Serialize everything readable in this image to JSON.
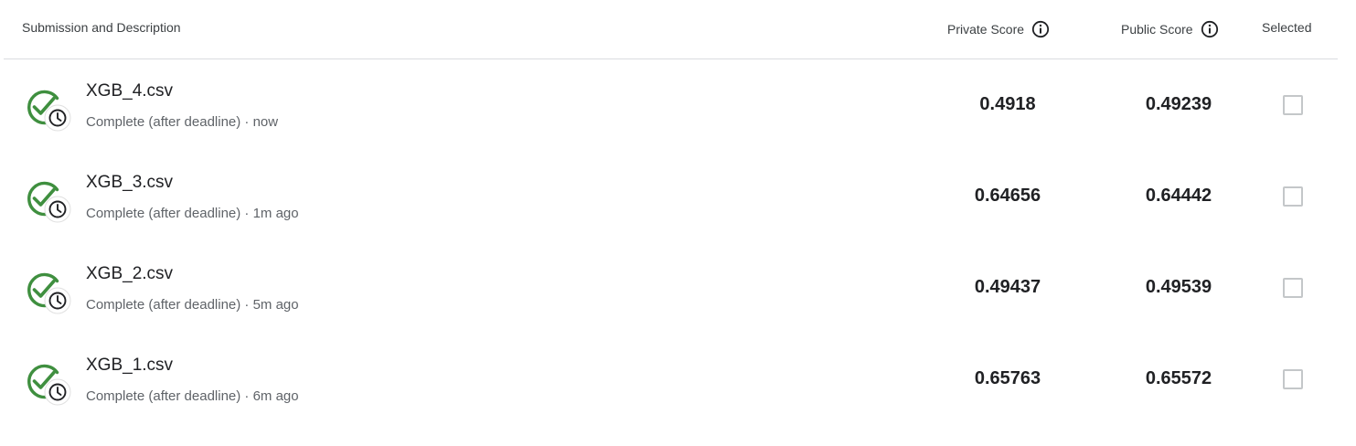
{
  "header": {
    "submission_label": "Submission and Description",
    "private_label": "Private Score",
    "public_label": "Public Score",
    "selected_label": "Selected"
  },
  "colors": {
    "success_green": "#3f8f3f",
    "divider": "#dadce0"
  },
  "rows": [
    {
      "file_name": "XGB_4.csv",
      "status": "Complete (after deadline) · now",
      "private_score": "0.4918",
      "public_score": "0.49239",
      "selected": false,
      "icon": "check-circle-with-clock-icon"
    },
    {
      "file_name": "XGB_3.csv",
      "status": "Complete (after deadline) · 1m ago",
      "private_score": "0.64656",
      "public_score": "0.64442",
      "selected": false,
      "icon": "check-circle-with-clock-icon"
    },
    {
      "file_name": "XGB_2.csv",
      "status": "Complete (after deadline) · 5m ago",
      "private_score": "0.49437",
      "public_score": "0.49539",
      "selected": false,
      "icon": "check-circle-with-clock-icon"
    },
    {
      "file_name": "XGB_1.csv",
      "status": "Complete (after deadline) · 6m ago",
      "private_score": "0.65763",
      "public_score": "0.65572",
      "selected": false,
      "icon": "check-circle-with-clock-icon"
    }
  ]
}
